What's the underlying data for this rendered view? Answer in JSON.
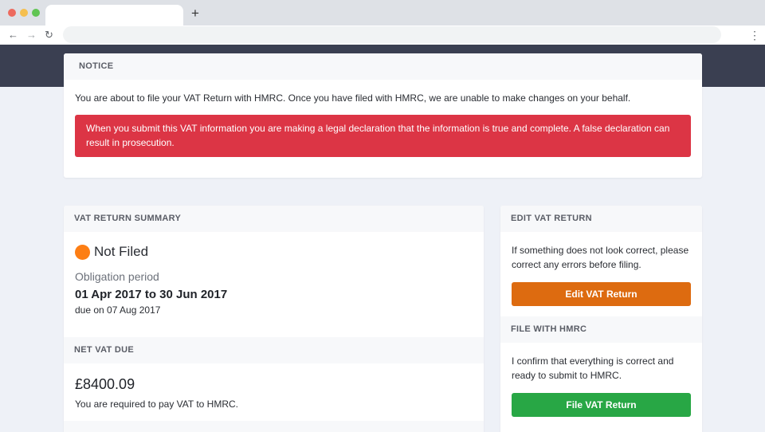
{
  "browser": {
    "new_tab_symbol": "+",
    "back_symbol": "←",
    "forward_symbol": "→",
    "reload_symbol": "↻",
    "menu_symbol": "⋮"
  },
  "notice": {
    "header": "NOTICE",
    "text": "You are about to file your VAT Return with HMRC. Once you have filed with HMRC, we are unable to make changes on your behalf.",
    "alert": "When you submit this VAT information you are making a legal declaration that the information is true and complete. A false declaration can result in prosecution."
  },
  "summary": {
    "header": "VAT RETURN SUMMARY",
    "status": "Not Filed",
    "obligation_label": "Obligation period",
    "period": "01 Apr 2017 to 30 Jun 2017",
    "due": "due on 07 Aug 2017"
  },
  "net_vat": {
    "header": "NET VAT DUE",
    "amount": "£8400.09",
    "note": "You are required to pay VAT to HMRC."
  },
  "edit": {
    "header": "EDIT VAT RETURN",
    "text": "If something does not look correct, please correct any errors before filing.",
    "button": "Edit VAT Return"
  },
  "file": {
    "header": "FILE WITH HMRC",
    "text": "I confirm that everything is correct and ready to submit to HMRC.",
    "button": "File VAT Return"
  },
  "colors": {
    "alert": "#dc3545",
    "status_not_filed": "#fd7e14",
    "edit_button": "#dd6b10",
    "file_button": "#28a745",
    "nav_band": "#3a3f51"
  }
}
